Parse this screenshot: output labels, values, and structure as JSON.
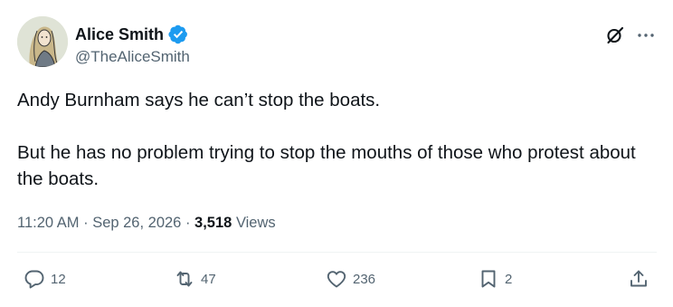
{
  "author": {
    "display_name": "Alice Smith",
    "handle": "@TheAliceSmith",
    "verified": true,
    "avatar_icon": "avatar-illustration"
  },
  "post": {
    "paragraphs": [
      "Andy Burnham says he can’t stop the boats.",
      "But he has no problem trying to stop the mouths of those who protest about the boats."
    ]
  },
  "meta": {
    "time": "11:20 AM",
    "separator": "·",
    "date": "Sep 26, 2026",
    "views_count": "3,518",
    "views_label": "Views"
  },
  "actions": {
    "replies": "12",
    "reposts": "47",
    "likes": "236",
    "bookmarks": "2"
  },
  "colors": {
    "text": "#0f1419",
    "secondary": "#536471",
    "verified_blue": "#1d9bf0",
    "divider": "#eff3f4"
  },
  "icons": {
    "verified": "verified-badge-icon",
    "grok": "grok-icon",
    "more": "more-icon",
    "reply": "reply-icon",
    "repost": "repost-icon",
    "like": "heart-icon",
    "bookmark": "bookmark-icon",
    "share": "share-icon"
  }
}
